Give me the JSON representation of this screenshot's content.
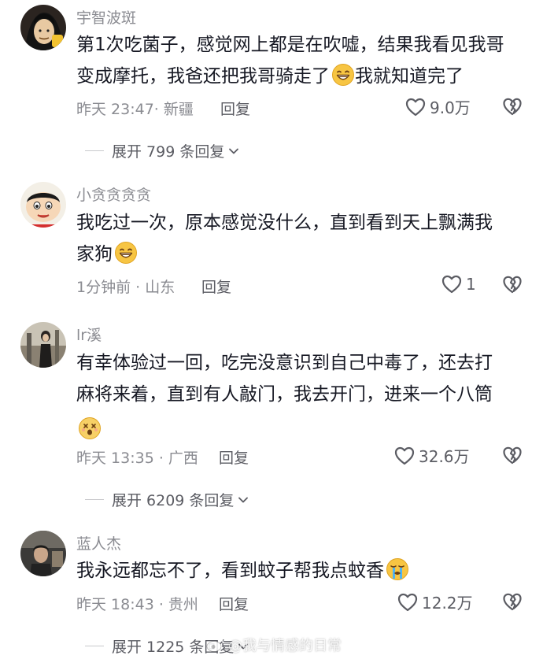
{
  "comments": [
    {
      "username": "宇智波斑",
      "lines": [
        "第1次吃菌子，感觉网上都是在吹嘘，结果我看见我哥",
        "变成摩托，我爸还把我哥骑走了",
        "我就知道完了"
      ],
      "meta": "昨天 23:47· 新疆",
      "reply_label": "回复",
      "likes": "9.0万",
      "expand": "展开 799 条回复"
    },
    {
      "username": "小贪贪贪贪",
      "lines": [
        "我吃过一次，原本感觉没什么，直到看到天上飘满我",
        "家狗"
      ],
      "meta": "1分钟前 · 山东",
      "reply_label": "回复",
      "likes": "1"
    },
    {
      "username": "lr溪",
      "lines": [
        "有幸体验过一回，吃完没意识到自己中毒了，还去打",
        "麻将来着，直到有人敲门，我去开门，进来一个八筒"
      ],
      "meta": "昨天 13:35 · 广西",
      "reply_label": "回复",
      "likes": "32.6万",
      "expand": "展开 6209 条回复"
    },
    {
      "username": "蓝人杰",
      "lines": [
        "我永远都忘不了，看到蚊子帮我点蚊香"
      ],
      "meta": "昨天 18:43 · 贵州",
      "reply_label": "回复",
      "likes": "12.2万",
      "expand": "展开 1225 条回复"
    }
  ],
  "watermark": "@我与情感的日常",
  "colors": {
    "text": "#161823",
    "secondary": "#8a8b91",
    "action": "#5b5c63"
  }
}
